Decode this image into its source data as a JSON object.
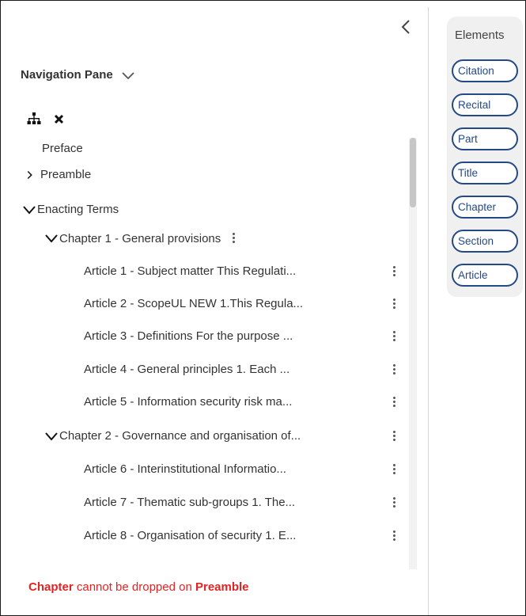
{
  "nav": {
    "title": "Navigation Pane",
    "tools": {
      "tree_icon": "sitemap-icon",
      "close_icon": "close-icon"
    },
    "tree": {
      "preface": "Preface",
      "preamble": "Preamble",
      "enacting_terms": "Enacting Terms",
      "chapter1": {
        "label": "Chapter 1 - General provisions",
        "articles": [
          "Article 1 - Subject matter This Regulati...",
          "Article 2 - ScopeUL NEW 1.This Regula...",
          "Article 3 - Definitions For the purpose ...",
          "Article 4 - General principles  1. Each ...",
          "Article 5 - Information security risk ma..."
        ]
      },
      "chapter2": {
        "label": "Chapter 2 - Governance and organisation of...",
        "articles": [
          "Article 6 - Interinstitutional Informatio...",
          "Article 7 - Thematic sub-groups 1. The...",
          "Article 8 - Organisation of security 1. E..."
        ]
      }
    },
    "drop_message": {
      "element": "Chapter",
      "middle": " cannot be dropped on ",
      "target": "Preamble"
    }
  },
  "elements": {
    "title": "Elements",
    "chips": [
      "Citation",
      "Recital",
      "Part",
      "Title",
      "Chapter",
      "Section",
      "Article"
    ]
  },
  "colors": {
    "chip_border": "#244a86",
    "error": "#e02424",
    "panel_bg": "#f0f0f0"
  }
}
